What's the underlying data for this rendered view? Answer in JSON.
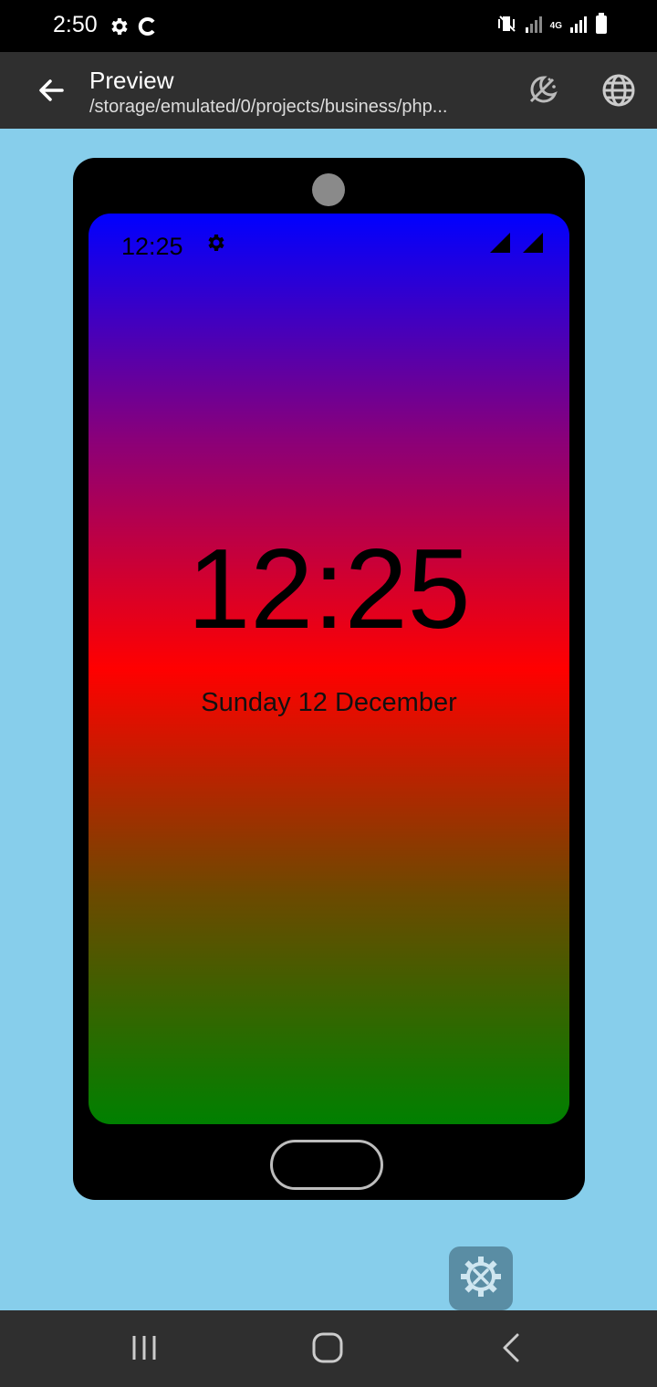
{
  "status_bar": {
    "time": "2:50",
    "network_label": "4G",
    "icons": [
      "gear-icon",
      "sync-icon",
      "vibrate-icon",
      "signal-icon",
      "battery-icon"
    ]
  },
  "app_bar": {
    "title": "Preview",
    "subtitle": "/storage/emulated/0/projects/business/php...",
    "actions": [
      "theme-toggle-icon",
      "globe-icon"
    ]
  },
  "device_preview": {
    "status_time": "12:25",
    "clock_time": "12:25",
    "date": "Sunday 12 December",
    "gradient_colors": [
      "#0000ff",
      "#8b0078",
      "#ff0000",
      "#6b4a00",
      "#008000"
    ]
  },
  "fab": {
    "icon": "tools-gear-icon"
  },
  "nav_bar": {
    "buttons": [
      "recent-apps-icon",
      "home-icon",
      "back-icon"
    ]
  },
  "colors": {
    "background": "#87CEEB",
    "app_bar": "#2f2f2f",
    "fab": "#5a8da4"
  }
}
